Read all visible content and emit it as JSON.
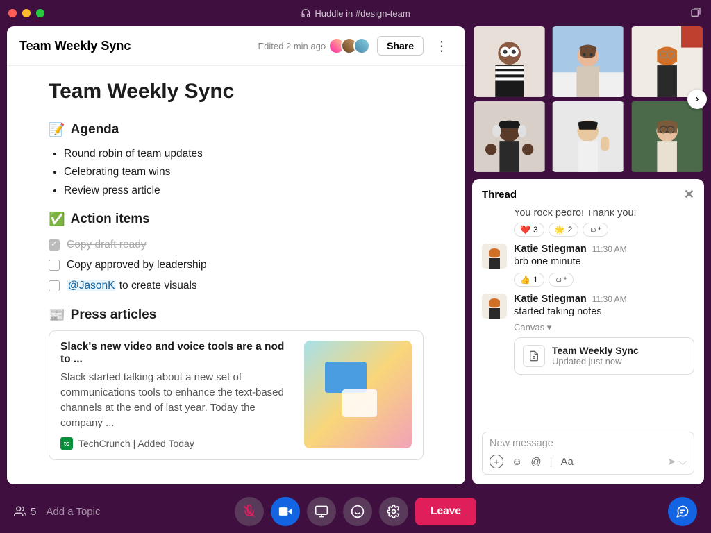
{
  "titlebar": {
    "title": "Huddle in #design-team"
  },
  "canvas": {
    "header_title": "Team Weekly Sync",
    "edited": "Edited 2 min ago",
    "share": "Share",
    "doc_title": "Team Weekly Sync",
    "agenda_heading": "Agenda",
    "agenda_items": [
      "Round robin of team updates",
      "Celebrating team wins",
      "Review press article"
    ],
    "actions_heading": "Action items",
    "action_items": [
      {
        "done": true,
        "label": "Copy draft ready"
      },
      {
        "done": false,
        "label": "Copy approved by leadership"
      },
      {
        "done": false,
        "mention": "@JasonK",
        "rest": " to create visuals"
      }
    ],
    "press_heading": "Press articles",
    "card": {
      "title": "Slack's new video and voice tools are a nod to ...",
      "desc": "Slack started talking about a new set of communications tools to enhance the text-based channels at the end of last year. Today the company ...",
      "source": "TechCrunch | Added Today"
    }
  },
  "thread": {
    "title": "Thread",
    "cut_msg": "You rock pedro! Thank you!",
    "reacts_top": [
      {
        "e": "❤️",
        "c": "3"
      },
      {
        "e": "🌟",
        "c": "2"
      }
    ],
    "m1": {
      "name": "Katie Stiegman",
      "time": "11:30 AM",
      "body": "brb one minute",
      "reacts": [
        {
          "e": "👍",
          "c": "1"
        }
      ]
    },
    "m2": {
      "name": "Katie Stiegman",
      "time": "11:30 AM",
      "body": "started taking notes",
      "chip": "Canvas ▾",
      "card_title": "Team Weekly Sync",
      "card_sub": "Updated just now"
    },
    "composer_placeholder": "New message"
  },
  "bottombar": {
    "participants": "5",
    "topic_placeholder": "Add a Topic",
    "leave": "Leave"
  }
}
